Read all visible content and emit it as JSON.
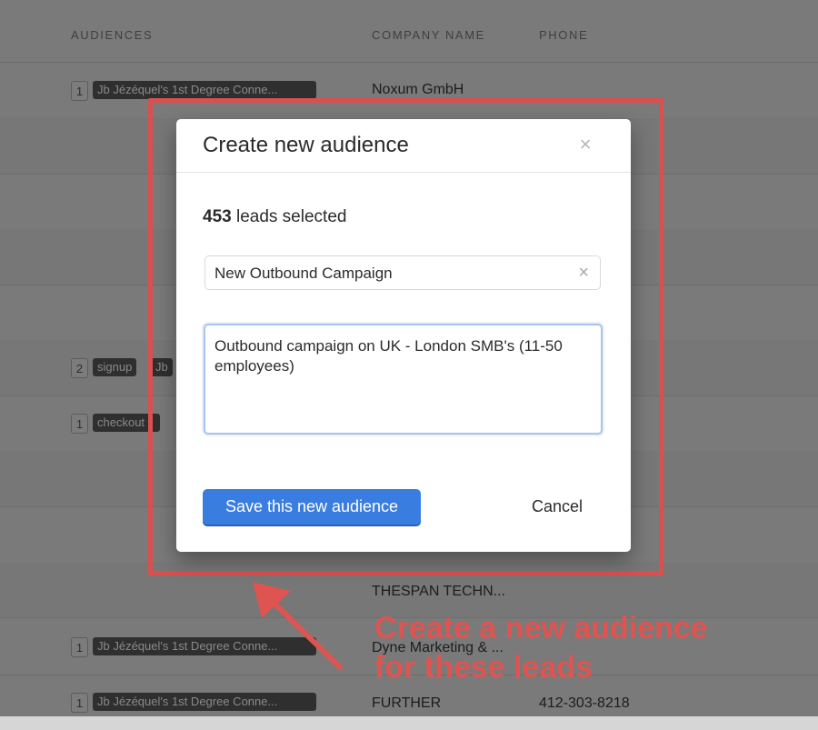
{
  "table": {
    "headers": {
      "audiences": "AUDIENCES",
      "company": "COMPANY NAME",
      "phone": "PHONE"
    },
    "rows": [
      {
        "count": "1",
        "tags": [
          "Jb Jézéquel's 1st Degree Conne..."
        ],
        "company": "Noxum GmbH",
        "phone": ""
      },
      {
        "count": "",
        "tags": [],
        "company": "",
        "phone": ""
      },
      {
        "count": "",
        "tags": [],
        "company": "",
        "phone": ""
      },
      {
        "count": "",
        "tags": [],
        "company": "",
        "phone": ""
      },
      {
        "count": "",
        "tags": [],
        "company": "",
        "phone": ""
      },
      {
        "count": "2",
        "tags": [
          "signup",
          "Jb"
        ],
        "company": "",
        "phone": ""
      },
      {
        "count": "1",
        "tags": [
          "checkout"
        ],
        "company": "",
        "phone": ""
      },
      {
        "count": "",
        "tags": [],
        "company": "",
        "phone": ""
      },
      {
        "count": "",
        "tags": [],
        "company": "",
        "phone": ""
      },
      {
        "count": "",
        "tags": [],
        "company": "THESPAN TECHN...",
        "phone": ""
      },
      {
        "count": "1",
        "tags": [
          "Jb Jézéquel's 1st Degree Conne..."
        ],
        "company": "Dyne Marketing & ...",
        "phone": ""
      },
      {
        "count": "1",
        "tags": [
          "Jb Jézéquel's 1st Degree Conne..."
        ],
        "company": "FURTHER",
        "phone": "412-303-8218"
      }
    ]
  },
  "modal": {
    "title": "Create new audience",
    "close_icon": "×",
    "leads_count": "453",
    "leads_text": " leads selected",
    "name_value": "New Outbound Campaign",
    "clear_icon": "×",
    "description_value": "Outbound campaign on UK - London SMB's (11-50 employees)",
    "save_label": "Save this new audience",
    "cancel_label": "Cancel"
  },
  "annotation": {
    "line1": "Create a new audience",
    "line2": "for these leads",
    "color": "#de5451"
  }
}
